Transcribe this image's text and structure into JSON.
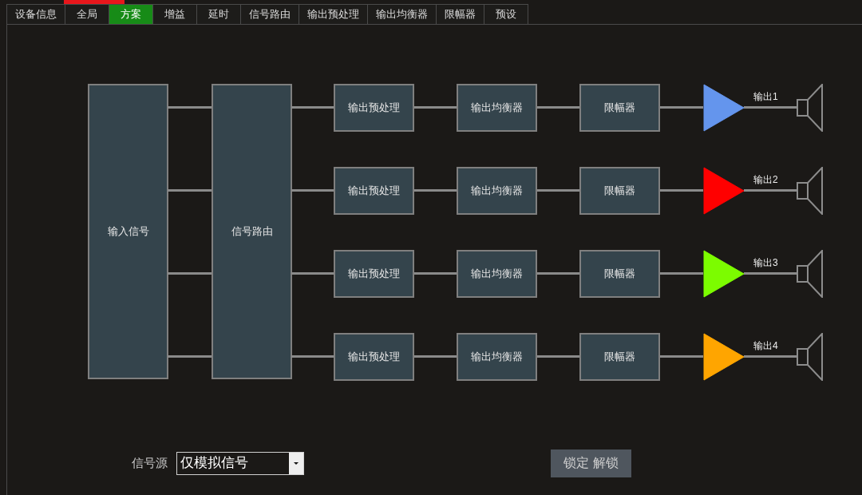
{
  "tabs": [
    {
      "label": "设备信息",
      "selected": false
    },
    {
      "label": "全局",
      "selected": false
    },
    {
      "label": "方案",
      "selected": true
    },
    {
      "label": "增益",
      "selected": false
    },
    {
      "label": "延时",
      "selected": false
    },
    {
      "label": "信号路由",
      "selected": false
    },
    {
      "label": "输出预处理",
      "selected": false
    },
    {
      "label": "输出均衡器",
      "selected": false
    },
    {
      "label": "限幅器",
      "selected": false
    },
    {
      "label": "预设",
      "selected": false
    }
  ],
  "diagram": {
    "input_block": "输入信号",
    "routing_block": "信号路由",
    "channels": [
      {
        "stages": [
          "输出预处理",
          "输出均衡器",
          "限幅器"
        ],
        "color": "#6495ed",
        "output_label": "输出1"
      },
      {
        "stages": [
          "输出预处理",
          "输出均衡器",
          "限幅器"
        ],
        "color": "#ff0000",
        "output_label": "输出2"
      },
      {
        "stages": [
          "输出预处理",
          "输出均衡器",
          "限幅器"
        ],
        "color": "#7cfc00",
        "output_label": "输出3"
      },
      {
        "stages": [
          "输出预处理",
          "输出均衡器",
          "限幅器"
        ],
        "color": "#ffa500",
        "output_label": "输出4"
      }
    ]
  },
  "signal_source": {
    "label": "信号源",
    "value": "仅模拟信号"
  },
  "lock_button": {
    "label": "锁定 解锁"
  }
}
